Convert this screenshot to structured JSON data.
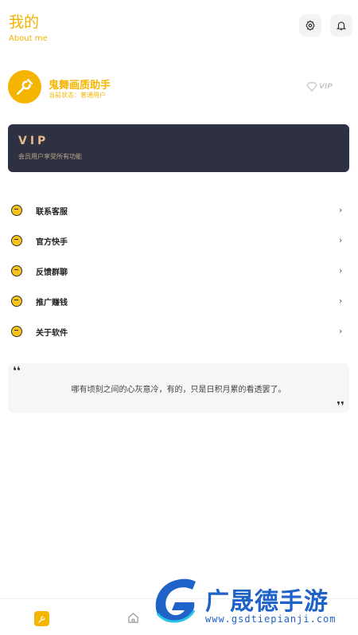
{
  "header": {
    "title": "我的",
    "subtitle": "About me",
    "settings_icon": "settings-gear-icon",
    "bell_icon": "bell-icon"
  },
  "profile": {
    "name": "鬼舞画质助手",
    "status": "当前状态：普通用户",
    "badge": "VIP"
  },
  "vip_card": {
    "title": "VIP",
    "description": "会员用户享受所有功能"
  },
  "menu": {
    "items": [
      {
        "label": "联系客服",
        "icon": "customer-service-icon"
      },
      {
        "label": "官方快手",
        "icon": "kuaishou-icon"
      },
      {
        "label": "反馈群聊",
        "icon": "group-chat-icon"
      },
      {
        "label": "推广赚钱",
        "icon": "promote-icon"
      },
      {
        "label": "关于软件",
        "icon": "about-icon"
      }
    ],
    "chevron": "›"
  },
  "quote": {
    "open": "❛❛",
    "text": "哪有顷刻之间的心灰意冷，有的，只是日积月累的看透罢了。",
    "close": "❜❜"
  },
  "watermark": {
    "title": "广晟德手游",
    "url": "www.gsdtiepianji.com"
  },
  "colors": {
    "accent": "#f5b400",
    "vip_card_bg": "#2e3142",
    "vip_gold": "#e6b98b",
    "watermark_blue": "#1f63c9"
  }
}
